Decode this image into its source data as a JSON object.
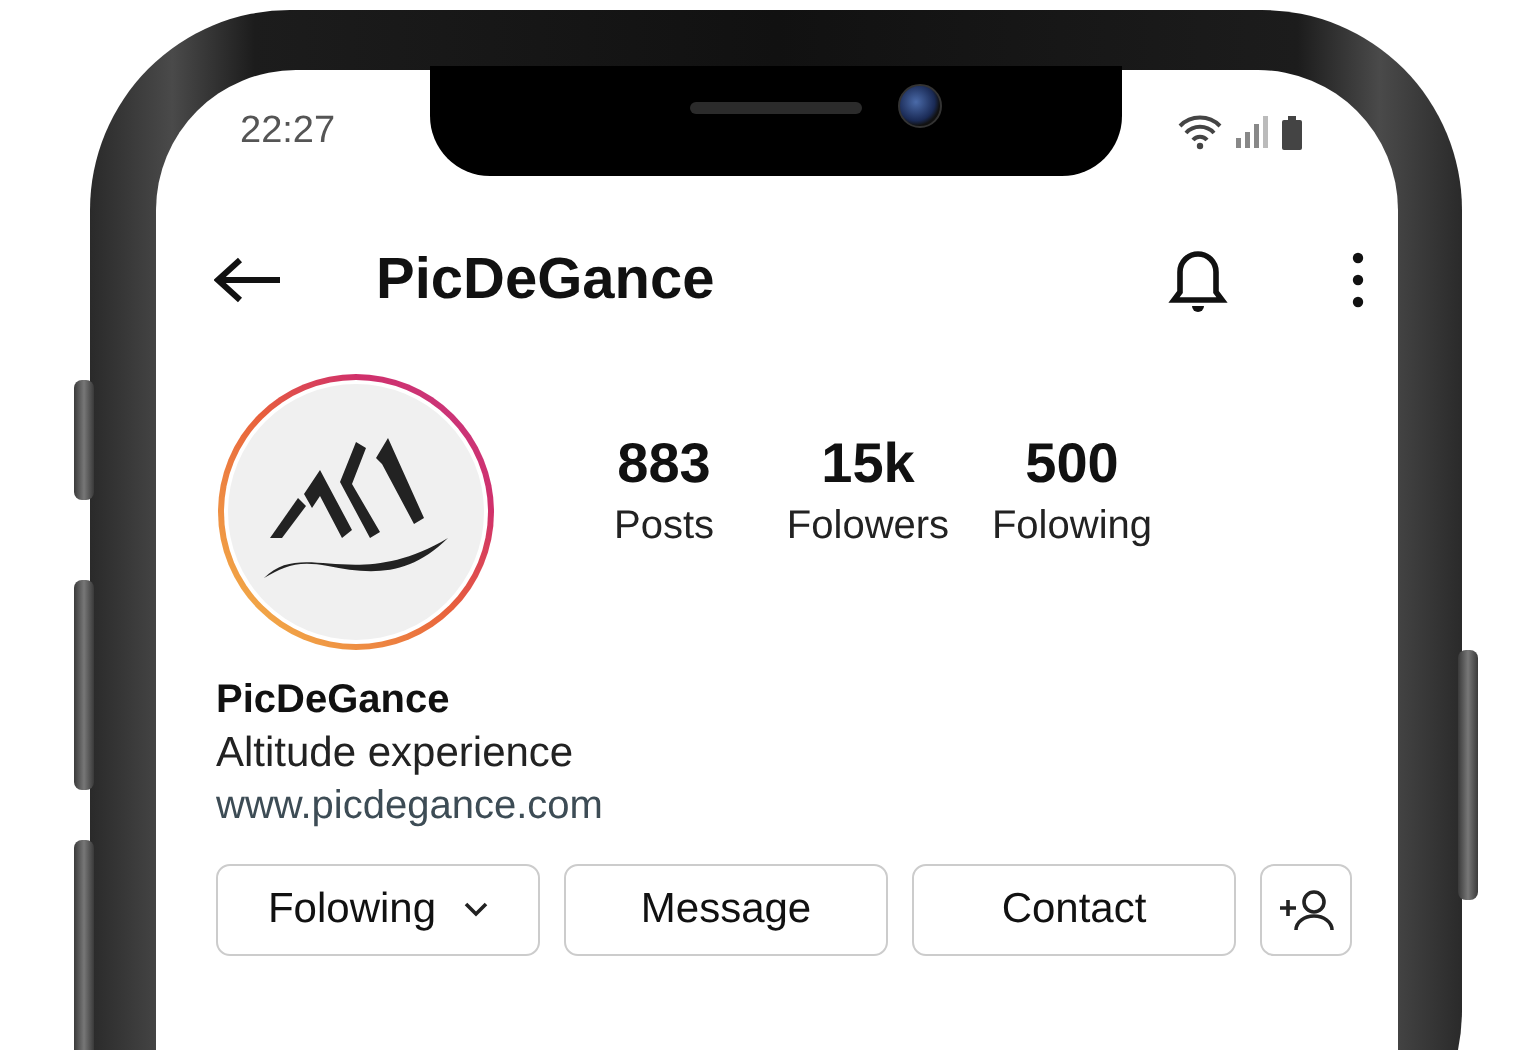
{
  "status_bar": {
    "time": "22:27"
  },
  "header": {
    "title": "PicDeGance"
  },
  "profile": {
    "stats": [
      {
        "value": "883",
        "label": "Posts"
      },
      {
        "value": "15k",
        "label": "Folowers"
      },
      {
        "value": "500",
        "label": "Folowing"
      }
    ],
    "name": "PicDeGance",
    "bio": "Altitude experience",
    "website": "www.picdegance.com"
  },
  "buttons": [
    {
      "kind": "dropdown",
      "label": "Folowing"
    },
    {
      "kind": "plain",
      "label": "Message"
    },
    {
      "kind": "plain",
      "label": "Contact"
    },
    {
      "kind": "add-person"
    }
  ]
}
